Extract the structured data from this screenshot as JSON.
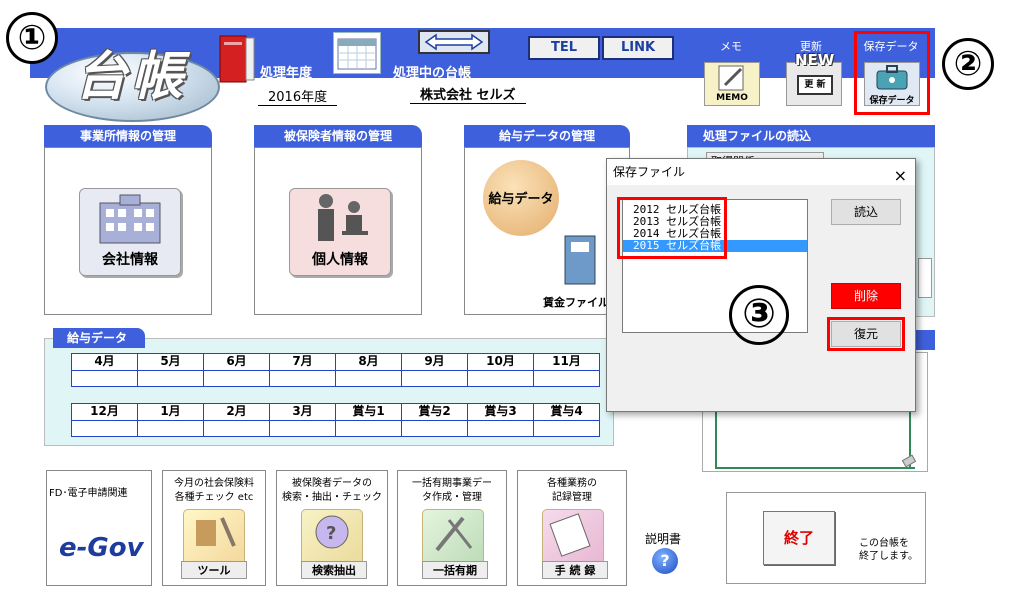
{
  "annotations": {
    "one": "①",
    "two": "②",
    "three": "③"
  },
  "header": {
    "logo_text": "台帳",
    "fiscal_year_label": "処理年度",
    "fiscal_year_value": "2016年度",
    "current_ledger_label": "処理中の台帳",
    "current_ledger_value": "株式会社 セルズ",
    "tel_button": "TEL",
    "link_button": "LINK",
    "memo_label": "メモ",
    "memo_icon_text": "MEMO",
    "update_label": "更新",
    "update_icon_new": "NEW",
    "update_icon_text": "更 新",
    "save_label": "保存データ",
    "save_icon_text": "保存データ"
  },
  "panels": {
    "office": {
      "tab": "事業所情報の管理",
      "button": "会社情報"
    },
    "insured": {
      "tab": "被保険者情報の管理",
      "button": "個人情報"
    },
    "salary": {
      "tab": "給与データの管理",
      "button": "給与データ",
      "ledger": "賃金ファイル"
    },
    "file_load": {
      "tab": "処理ファイルの読込",
      "partial": "取得関係"
    }
  },
  "salary_table": {
    "tab": "給与データ",
    "row1": [
      "4月",
      "5月",
      "6月",
      "7月",
      "8月",
      "9月",
      "10月",
      "11月"
    ],
    "row2": [
      "12月",
      "1月",
      "2月",
      "3月",
      "賞与1",
      "賞与2",
      "賞与3",
      "賞与4"
    ]
  },
  "tools": [
    {
      "text": "FD･電子申請関連",
      "caption": "e-Gov"
    },
    {
      "text": "今月の社会保険料\n各種チェック etc",
      "caption": "ツール"
    },
    {
      "text": "被保険者データの\n検索・抽出・チェック",
      "caption": "検索抽出"
    },
    {
      "text": "一括有期事業デー\nタ作成・管理",
      "caption": "一括有期"
    },
    {
      "text": "各種業務の\n記録管理",
      "caption": "手 続 録"
    }
  ],
  "manual": {
    "label": "説明書",
    "icon": "?"
  },
  "exit": {
    "button": "終了",
    "desc": "この台帳を\n終了します。"
  },
  "dialog": {
    "title": "保存ファイル",
    "close": "×",
    "items": [
      "2012 セルズ台帳",
      "2013 セルズ台帳",
      "2014 セルズ台帳",
      "2015 セルズ台帳"
    ],
    "selected_index": 3,
    "load_button": "読込",
    "delete_button": "削除",
    "restore_button": "復元"
  },
  "colors": {
    "header_blue": "#3f60dc",
    "highlight_red": "#ff0000",
    "delete_red": "#ff0000"
  }
}
